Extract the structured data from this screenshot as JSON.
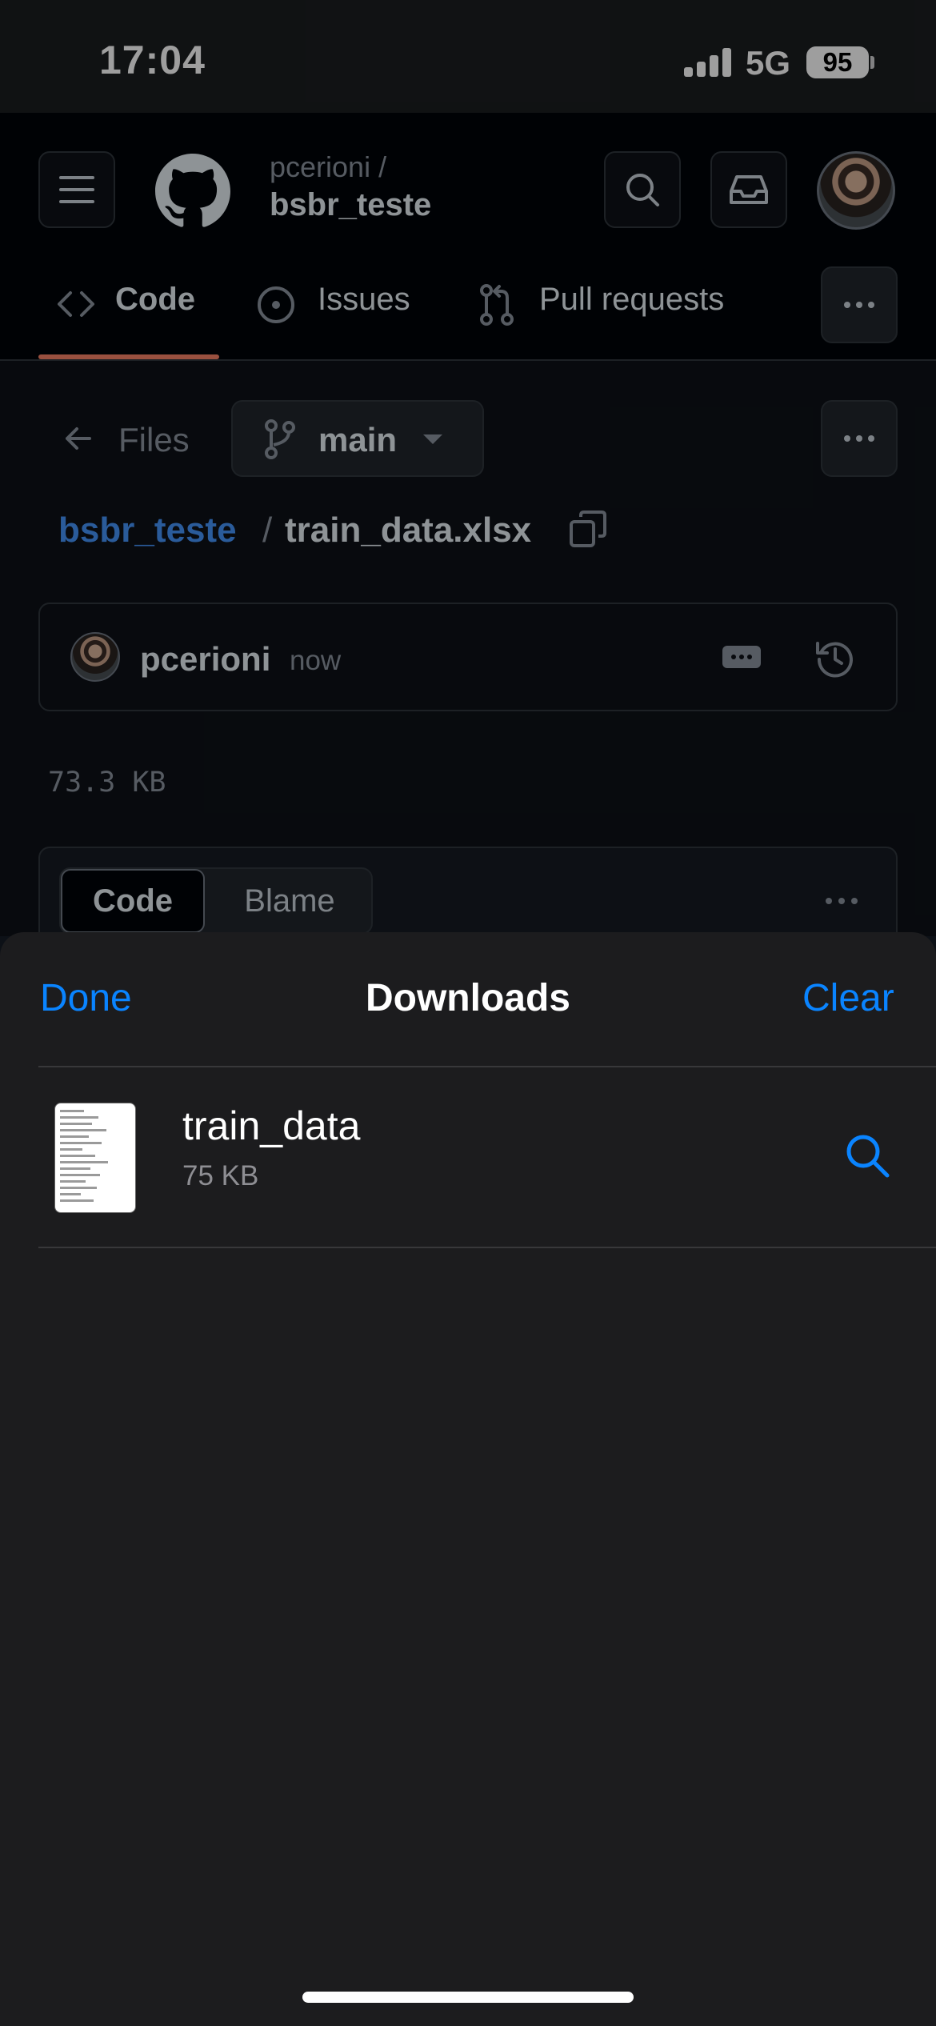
{
  "status_bar": {
    "time": "17:04",
    "network": "5G",
    "battery": "95"
  },
  "header": {
    "owner": "pcerioni /",
    "repo": "bsbr_teste"
  },
  "tabs": [
    {
      "label": "Code"
    },
    {
      "label": "Issues"
    },
    {
      "label": "Pull requests"
    }
  ],
  "file_nav": {
    "files_label": "Files",
    "branch": "main"
  },
  "breadcrumb": {
    "root": "bsbr_teste",
    "separator": "/",
    "file": "train_data.xlsx"
  },
  "commit": {
    "author": "pcerioni",
    "time": "now"
  },
  "file_size": "73.3 KB",
  "viewer": {
    "code_label": "Code",
    "blame_label": "Blame"
  },
  "downloads_sheet": {
    "done_label": "Done",
    "title": "Downloads",
    "clear_label": "Clear",
    "items": [
      {
        "name": "train_data",
        "size": "75 KB"
      }
    ]
  },
  "colors": {
    "accent_link": "#4493f8",
    "ios_blue": "#0a84ff",
    "tab_underline": "#f78166",
    "sheet_bg": "#1c1c1e"
  },
  "icons": [
    "menu-icon",
    "github-logo-icon",
    "search-icon",
    "inbox-icon",
    "code-icon",
    "issue-icon",
    "pull-request-icon",
    "kebab-icon",
    "arrow-left-icon",
    "branch-icon",
    "caret-down-icon",
    "copy-icon",
    "history-icon",
    "magnifier-icon"
  ]
}
